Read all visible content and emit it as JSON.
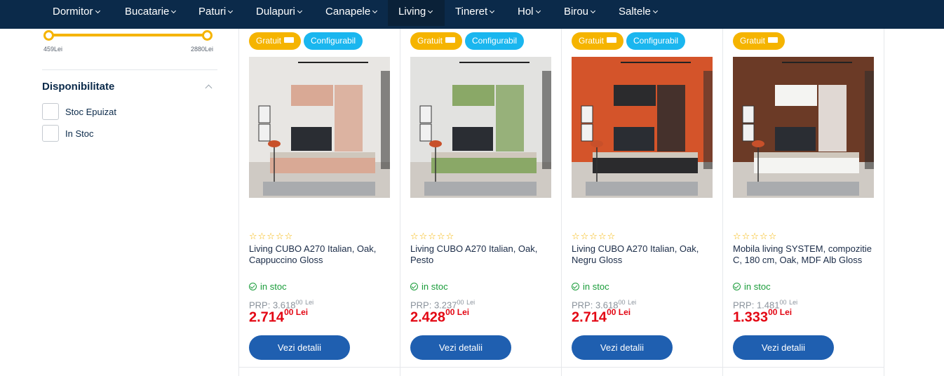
{
  "nav": {
    "items": [
      "Dormitor",
      "Bucatarie",
      "Paturi",
      "Dulapuri",
      "Canapele",
      "Living",
      "Tineret",
      "Hol",
      "Birou",
      "Saltele"
    ],
    "active": "Living"
  },
  "sidebar": {
    "price_min_label": "459Lei",
    "price_max_label": "2880Lei",
    "availability_title": "Disponibilitate",
    "options": [
      "Stoc Epuizat",
      "In Stoc"
    ]
  },
  "colors": {
    "nav_bg": "#0b2a4a",
    "accent_yellow": "#f5b400",
    "accent_blue": "#1ab6ef",
    "price_red": "#e30613",
    "button_blue": "#1f5fb0",
    "stock_green": "#1a9c3a"
  },
  "products": [
    {
      "badges": [
        "Gratuit",
        "Configurabil"
      ],
      "rating_stars": "☆☆☆☆☆",
      "name": "Living CUBO A270 Italian, Oak, Cappuccino Gloss",
      "stock": "in stoc",
      "prp_label": "PRP: 3.618",
      "prp_decimals": "00",
      "prp_currency": "Lei",
      "price_int": "2.714",
      "price_dec": "00 Lei",
      "button": "Vezi detalii",
      "wall_color": "#e8e6e3",
      "cabinet_color": "#d9a995"
    },
    {
      "badges": [
        "Gratuit",
        "Configurabil"
      ],
      "rating_stars": "☆☆☆☆☆",
      "name": "Living CUBO A270 Italian, Oak, Pesto",
      "stock": "in stoc",
      "prp_label": "PRP: 3.237",
      "prp_decimals": "00",
      "prp_currency": "Lei",
      "price_int": "2.428",
      "price_dec": "00 Lei",
      "button": "Vezi detalii",
      "wall_color": "#e2e2e0",
      "cabinet_color": "#8aa867"
    },
    {
      "badges": [
        "Gratuit",
        "Configurabil"
      ],
      "rating_stars": "☆☆☆☆☆",
      "name": "Living CUBO A270 Italian, Oak, Negru Gloss",
      "stock": "in stoc",
      "prp_label": "PRP: 3.618",
      "prp_decimals": "00",
      "prp_currency": "Lei",
      "price_int": "2.714",
      "price_dec": "00 Lei",
      "button": "Vezi detalii",
      "wall_color": "#d4542a",
      "cabinet_color": "#2b2b2d"
    },
    {
      "badges": [
        "Gratuit"
      ],
      "rating_stars": "☆☆☆☆☆",
      "name": "Mobila living SYSTEM, compozitie C, 180 cm, Oak, MDF Alb Gloss",
      "stock": "in stoc",
      "prp_label": "PRP: 1.481",
      "prp_decimals": "00",
      "prp_currency": "Lei",
      "price_int": "1.333",
      "price_dec": "00 Lei",
      "button": "Vezi detalii",
      "wall_color": "#6b3a26",
      "cabinet_color": "#f4f4f2"
    }
  ]
}
